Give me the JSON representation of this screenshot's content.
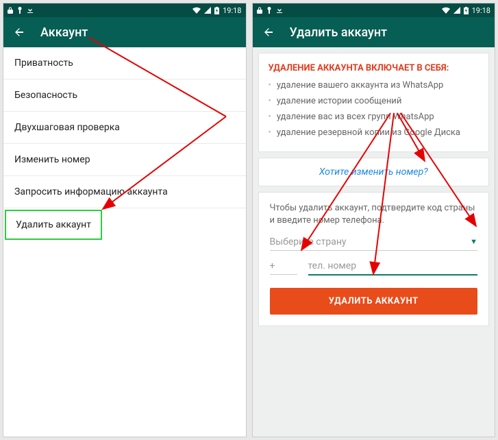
{
  "status": {
    "time": "19:18"
  },
  "screen1": {
    "title": "Аккаунт",
    "items": [
      "Приватность",
      "Безопасность",
      "Двухшаговая проверка",
      "Изменить номер",
      "Запросить информацию аккаунта",
      "Удалить аккаунт"
    ]
  },
  "screen2": {
    "title": "Удалить аккаунт",
    "warn_title": "УДАЛЕНИЕ АККАУНТА ВКЛЮЧАЕТ В СЕБЯ:",
    "bullets": [
      "удаление вашего аккаунта из WhatsApp",
      "удаление истории сообщений",
      "удаление вас из всех групп WhatsApp",
      "удаление резервной копии из Google Диска"
    ],
    "change_link": "Хотите изменить номер?",
    "form_text": "Чтобы удалить аккаунт, подтвердите код страны и введите номер телефона.",
    "country_placeholder": "Выберите страну",
    "plus": "+",
    "phone_placeholder": "тел. номер",
    "delete_button": "УДАЛИТЬ АККАУНТ"
  }
}
